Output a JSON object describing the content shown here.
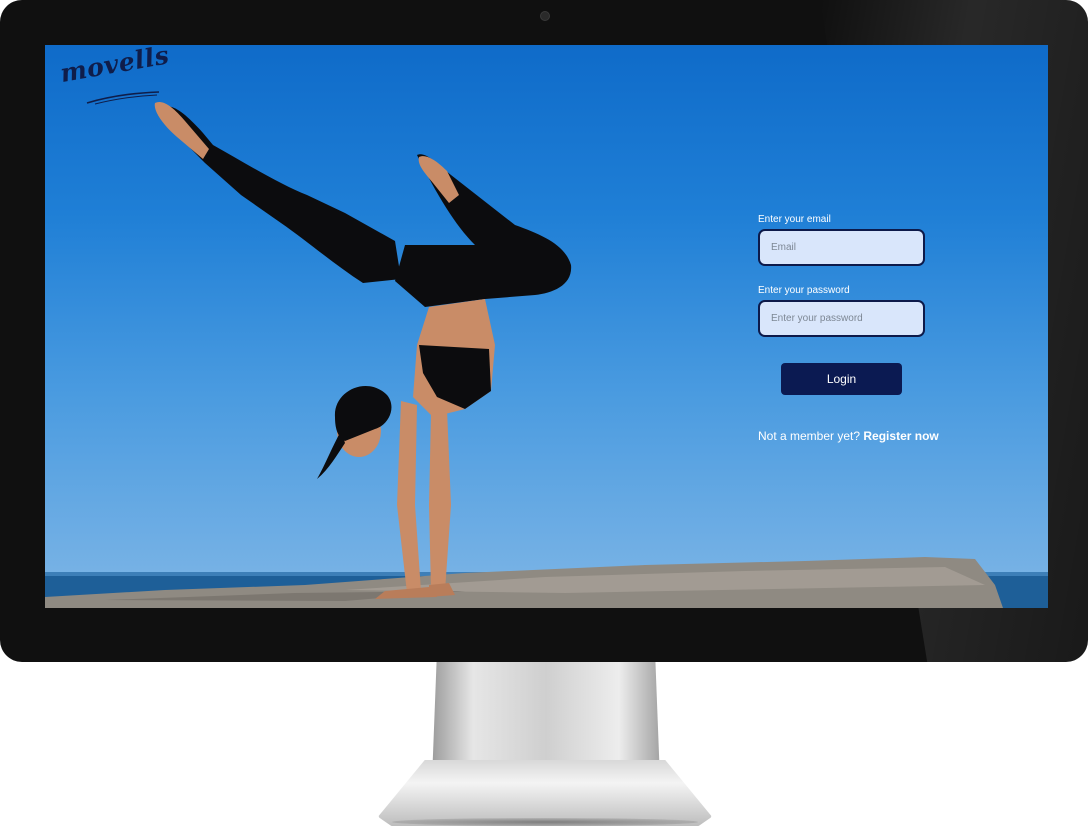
{
  "brand": {
    "logo_text": "movells"
  },
  "login_form": {
    "email_label": "Enter your email",
    "email_placeholder": "Email",
    "email_value": "",
    "password_label": "Enter your password",
    "password_placeholder": "Enter your password",
    "password_value": "",
    "login_label": "Login",
    "register_prompt": "Not a member yet?",
    "register_link": "Register now"
  },
  "colors": {
    "primary": "#0b1a52",
    "input_background": "#d9e6fb",
    "sky": "#1f7fd6"
  },
  "icons": [
    "camera-icon"
  ]
}
